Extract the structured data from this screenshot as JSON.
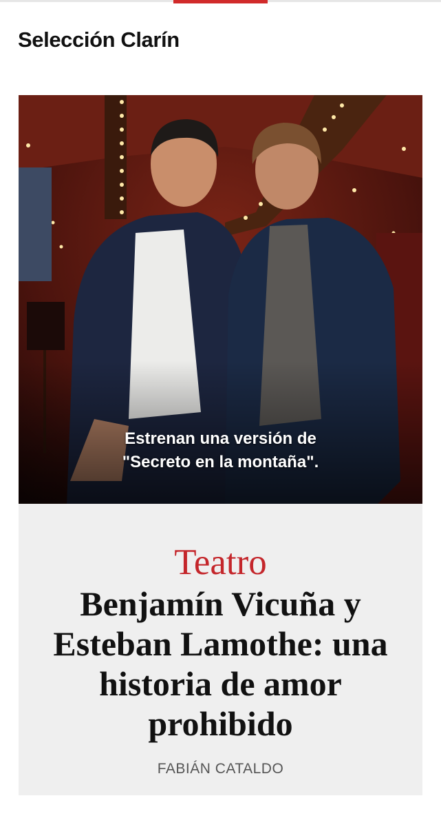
{
  "section": {
    "title": "Selección Clarín"
  },
  "article": {
    "caption_lines": [
      "Estrenan una versión de",
      "\"Secreto en la montaña\"."
    ],
    "kicker": "Teatro",
    "headline_lines": [
      "Benjamín Vicuña y",
      "Esteban Lamothe: una",
      "historia de amor",
      "prohibido"
    ],
    "author": "FABIÁN CATALDO"
  },
  "colors": {
    "accent": "#d12a2a",
    "kicker": "#c4262b",
    "card_bg": "#efefef"
  }
}
